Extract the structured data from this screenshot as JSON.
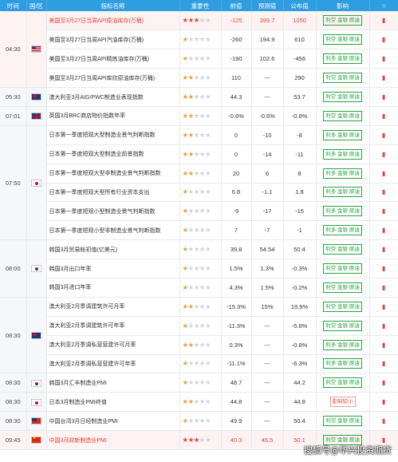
{
  "header": {
    "time": "时间",
    "region": "国/区",
    "indicator": "指标名称",
    "importance": "重要性",
    "previous": "前值",
    "forecast": "预测值",
    "actual": "公布值",
    "impact": "影响",
    "icon_col": "☆"
  },
  "rows": [
    {
      "time": "04:30",
      "flag": "us",
      "span": 4,
      "name": "美国至3月27日当周API原油库存(万桶)",
      "stars": 3,
      "prev": "-125",
      "fc": "399.7",
      "act": "1050",
      "imp": "利空 金银 原油",
      "hl": true
    },
    {
      "name": "美国至3月27日当周API汽油库存(万桶)",
      "stars": 1,
      "prev": "-260",
      "fc": "194.9",
      "act": "610",
      "imp": "利空 金银 原油"
    },
    {
      "name": "美国至3月27日当周API精炼油库存(万桶)",
      "stars": 1,
      "prev": "-190",
      "fc": "102.6",
      "act": "-456",
      "imp": "利多 金银 原油"
    },
    {
      "name": "美国至3月27日当周API库欣原油库存(万桶)",
      "stars": 2,
      "prev": "110",
      "fc": "---",
      "act": "290",
      "imp": "利空 金银 原油"
    },
    {
      "time": "05:30",
      "flag": "au",
      "span": 1,
      "name": "澳大利亚3月AIG/PWC制造业表现指数",
      "stars": 2,
      "prev": "44.3",
      "fc": "---",
      "act": "53.7",
      "imp": "利空 金银 原油"
    },
    {
      "time": "07:01",
      "flag": "gb",
      "span": 1,
      "name": "英国3月BRC商店物价指数年率",
      "stars": 2,
      "prev": "-0.6%",
      "fc": "-0.6%",
      "act": "-0.8%",
      "imp": "利空 金银 原油"
    },
    {
      "time": "07:50",
      "flag": "jp",
      "span": 6,
      "name": "日本第一季度短观大型制造业景气判断指数",
      "stars": 2,
      "prev": "0",
      "fc": "-10",
      "act": "-8",
      "imp": "利多 金银 原油"
    },
    {
      "name": "日本第一季度短观大型制造业前景指数",
      "stars": 2,
      "prev": "0",
      "fc": "-14",
      "act": "-11",
      "imp": "利多 金银 原油"
    },
    {
      "name": "日本第一季度短观大型非制造业景气判断指数",
      "stars": 2,
      "prev": "20",
      "fc": "6",
      "act": "8",
      "imp": "利多 金银 原油"
    },
    {
      "name": "日本第一季度短观大型所有行业资本支出",
      "stars": 1,
      "prev": "6.8",
      "fc": "-1.1",
      "act": "1.8",
      "imp": "利多 金银 原油"
    },
    {
      "name": "日本第一季度短观小型制造业景气判断指数",
      "stars": 1,
      "prev": "-9",
      "fc": "-17",
      "act": "-15",
      "imp": "利多 金银 原油"
    },
    {
      "name": "日本第一季度短观小型非制造业景气判断指数",
      "stars": 1,
      "prev": "7",
      "fc": "-7",
      "act": "-1",
      "imp": "利多 金银 原油"
    },
    {
      "time": "08:00",
      "flag": "kr",
      "span": 3,
      "name": "韩国3月贸易帐初值(亿美元)",
      "stars": 1,
      "prev": "39.8",
      "fc": "54.54",
      "act": "50.4",
      "imp": "利空 金银 原油"
    },
    {
      "name": "韩国3月出口年率",
      "stars": 1,
      "prev": "1.5%",
      "fc": "1.3%",
      "act": "-0.3%",
      "imp": "利空 金银 原油"
    },
    {
      "name": "韩国3月进口年率",
      "stars": 1,
      "prev": "4.3%",
      "fc": "1.5%",
      "act": "-0.2%",
      "imp": "利空 金银 原油"
    },
    {
      "time": "08:30",
      "flag": "au",
      "span": 4,
      "name": "澳大利亚2月季调建筑许可月率",
      "stars": 2,
      "prev": "-15.3%",
      "fc": "15%",
      "act": "19.9%",
      "imp": "利空 金银 原油"
    },
    {
      "name": "澳大利亚2月季调建筑许可年率",
      "stars": 1,
      "prev": "-11.3%",
      "fc": "---",
      "act": "-5.8%",
      "imp": "利空 金银 原油"
    },
    {
      "name": "澳大利亚2月季调私营营建许可月率",
      "stars": 2,
      "prev": "0.3%",
      "fc": "---",
      "act": "-0.8%",
      "imp": "利多 金银 原油"
    },
    {
      "name": "澳大利亚2月季调私营营建许可年率",
      "stars": 1,
      "prev": "-11.1%",
      "fc": "---",
      "act": "-6.3%",
      "imp": "利多 金银 原油"
    },
    {
      "time": "08:30",
      "flag": "kr",
      "span": 1,
      "name": "韩国3月汇丰制造业PMI",
      "stars": 1,
      "prev": "48.7",
      "fc": "---",
      "act": "44.2",
      "imp": "利空 金银 原油"
    },
    {
      "time": "08:30",
      "flag": "jp",
      "span": 1,
      "name": "日本3月制造业PMI终值",
      "stars": 2,
      "prev": "44.8",
      "fc": "---",
      "act": "44.8",
      "imp": "影响较小",
      "neutral": true
    },
    {
      "time": "08:30",
      "flag": "tw",
      "span": 1,
      "name": "中国台湾3月日经制造业PMI",
      "stars": 1,
      "prev": "49.9",
      "fc": "---",
      "act": "50.4",
      "imp": "利空 金银 原油"
    },
    {
      "time": "09:45",
      "flag": "cn",
      "span": 1,
      "name": "中国3月财新制造业PMI",
      "stars": 3,
      "prev": "40.3",
      "fc": "45.5",
      "act": "50.1",
      "imp": "利空 金银 原油",
      "hl": true
    }
  ],
  "watermark": "搜狐号@华兴投资期货",
  "colors": {
    "accent": "#2f9ee0",
    "bearish": "#27a243",
    "bullish": "#e2433b"
  }
}
